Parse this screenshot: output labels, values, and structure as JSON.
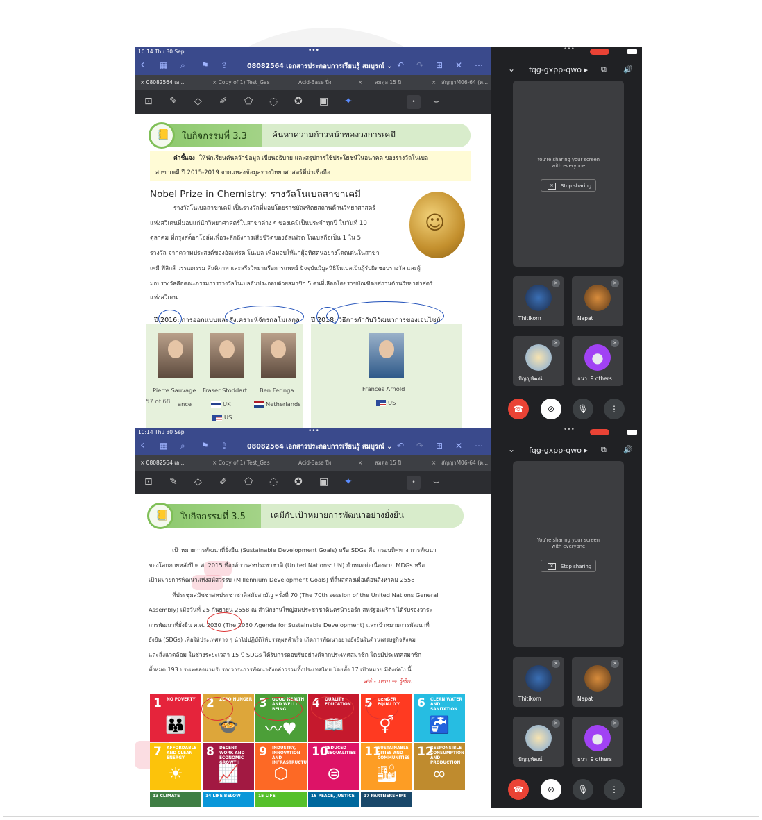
{
  "screens": [
    {
      "status_time": "10:14  Thu 30 Sep",
      "doc_title": "08082564 เอกสารประกอบการเรียนรู้ สมบูรณ์ ⌄",
      "tabs": [
        "× 08082564 เอ...",
        "× Copy of 1) Test_Gas",
        "Acid-Base ปี่ง",
        "×",
        "สมดุล 15 ปี",
        "×",
        "สัญญาM06-64 (ต..."
      ],
      "activity_label": "ใบกิจกรรมที่ 3.3",
      "activity_title": "ค้นหาความก้าวหน้าของวงการเคมี",
      "instruction_label": "คำชี้แจง",
      "instruction_text": "ให้นักเรียนค้นคว้าข้อมูล เขียนอธิบาย และสรุปการใช้ประโยชน์ในอนาคต ของรางวัลโนเบล",
      "instruction_text2": "สาขาเคมี ปี 2015-2019 จากแหล่งข้อมูลทางวิทยาศาสตร์ที่น่าเชื่อถือ",
      "heading": "Nobel Prize in Chemistry: รางวัลโนเบลสาขาเคมี",
      "paragraph": [
        "รางวัลโนเบลสาขาเคมี เป็นรางวัลที่มอบโดยราชบัณฑิตยสถานด้านวิทยาศาสตร์",
        "แห่งสวีเดนที่มอบแก่นักวิทยาศาสตร์ในสาขาต่าง ๆ ของเคมีเป็นประจำทุกปี ในวันที่ 10",
        "ตุลาคม ที่กรุงสต็อกโฮล์มเพื่อระลึกถึงการเสียชีวิตของอัลเฟรด โนเบลถือเป็น 1 ใน 5",
        "รางวัล จากความประสงค์ของอัลเฟรด โนเบล เพื่อมอบให้แก่ผู้อุทิศตนอย่างโดดเด่นในสาขา",
        "เคมี ฟิสิกส์ วรรณกรรม สันติภาพ และสรีรวิทยาหรือการแพทย์ ปัจจุบันมีมูลนิธิโนเบลเป็นผู้รับผิดชอบรางวัล และผู้",
        "มอบรางวัลคือคณะกรรมการรางวัลโนเบลอันประกอบด้วยสมาชิก 5 คนที่เลือกโดยราชบัณฑิตยสถานด้านวิทยาศาสตร์",
        "แห่งสวีเดน"
      ],
      "year_left": "ปี 2016: การออกแบบและสังเคราะห์จักรกลโมเลกุล",
      "year_right": "ปี 2018: วิธีการกำกับวิวัฒนาการของเอนไซม์",
      "laureates": [
        {
          "name": "Pierre Sauvage",
          "country": "ance"
        },
        {
          "name": "Fraser Stoddart",
          "country": "UK",
          "country2": "US"
        },
        {
          "name": "Ben Feringa",
          "country": "Netherlands"
        },
        {
          "name": "Frances Arnold",
          "country": "US"
        }
      ],
      "page_indicator": "57 of 68"
    },
    {
      "status_time": "10:14  Thu 30 Sep",
      "doc_title": "08082564 เอกสารประกอบการเรียนรู้ สมบูรณ์ ⌄",
      "tabs": [
        "× 08082564 เอ...",
        "× Copy of 1) Test_Gas",
        "Acid-Base ปี่ง",
        "×",
        "สมดุล 15 ปี",
        "×",
        "สัญญาM06-64 (ต..."
      ],
      "activity_label": "ใบกิจกรรมที่ 3.5",
      "activity_title": "เคมีกับเป้าหมายการพัฒนาอย่างยั่งยืน",
      "paragraph": [
        "เป้าหมายการพัฒนาที่ยั่งยืน (Sustainable Development Goals) หรือ SDGs คือ กรอบทิศทาง การพัฒนา",
        "ของโลกภายหลังปี ค.ศ. 2015 ที่องค์การสหประชาชาติ (United Nations: UN) กำหนดต่อเนื่องจาก MDGs หรือ",
        "เป้าหมายการพัฒนาแห่งสหัสวรรษ (Millennium Development Goals) ที่สิ้นสุดลงเมื่อเดือนสิงหาคม 2558",
        "ที่ประชุมสมัชชาสหประชาชาติสมัยสามัญ ครั้งที่ 70 (The 70th session of the United Nations General",
        "Assembly) เมื่อวันที่ 25 กันยายน 2558 ณ สำนักงานใหญ่สหประชาชาตินครนิวยอร์ก สหรัฐอเมริกา ได้รับรองวาระ",
        "การพัฒนาที่ยั่งยืน ค.ศ. 2030 (The 2030 Agenda for Sustainable Development) และเป้าหมายการพัฒนาที่",
        "ยั่งยืน (SDGs) เพื่อให้ประเทศต่าง ๆ นำไปปฏิบัติให้บรรลุผลสำเร็จ เกิดการพัฒนาอย่างยั่งยืนในด้านเศรษฐกิจสังคม",
        "และสิ่งแวดล้อม ในช่วงระยะเวลา 15 ปี SDGs ได้รับการตอบรับอย่างดีจากประเทศสมาชิก โดยมีประเทศสมาชิก",
        "ทั้งหมด 193 ประเทศลงนามรับรองวาระการพัฒนาดังกล่าวรวมทั้งประเทศไทย โดยทั้ง 17 เป้าหมาย มีดังต่อไปนี้"
      ],
      "handwritten": "สซ์ - กขก  →  รู้ซ็ก.",
      "sdgs": [
        {
          "num": "1",
          "title": "NO POVERTY",
          "glyph": "👪",
          "color": "#e5243b"
        },
        {
          "num": "2",
          "title": "ZERO HUNGER",
          "glyph": "🍲",
          "color": "#dda63a"
        },
        {
          "num": "3",
          "title": "GOOD HEALTH AND WELL-BEING",
          "glyph": "〰♥",
          "color": "#4c9f38"
        },
        {
          "num": "4",
          "title": "QUALITY EDUCATION",
          "glyph": "📖",
          "color": "#c5192d"
        },
        {
          "num": "5",
          "title": "GENDER EQUALITY",
          "glyph": "⚥",
          "color": "#ff3a21"
        },
        {
          "num": "6",
          "title": "CLEAN WATER AND SANITATION",
          "glyph": "🚰",
          "color": "#26bde2"
        },
        {
          "num": "7",
          "title": "AFFORDABLE AND CLEAN ENERGY",
          "glyph": "☀",
          "color": "#fcc30b"
        },
        {
          "num": "8",
          "title": "DECENT WORK AND ECONOMIC GROWTH",
          "glyph": "📈",
          "color": "#a21942"
        },
        {
          "num": "9",
          "title": "INDUSTRY, INNOVATION AND INFRASTRUCTURE",
          "glyph": "⬡",
          "color": "#fd6925"
        },
        {
          "num": "10",
          "title": "REDUCED INEQUALITIES",
          "glyph": "⊜",
          "color": "#dd1367"
        },
        {
          "num": "11",
          "title": "SUSTAINABLE CITIES AND COMMUNITIES",
          "glyph": "🏙",
          "color": "#fd9d24"
        },
        {
          "num": "12",
          "title": "RESPONSIBLE CONSUMPTION AND PRODUCTION",
          "glyph": "∞",
          "color": "#bf8b2e"
        }
      ],
      "sdgs_row3": [
        "13 CLIMATE",
        "14 LIFE BELOW",
        "15 LIFE",
        "16 PEACE, JUSTICE",
        "17 PARTNERSHIPS"
      ]
    }
  ],
  "meet": {
    "meeting_code": "fqg-gxpp-qwo ▸",
    "sharing_text": "You're sharing your screen",
    "sharing_text2": "with everyone",
    "stop_sharing": "Stop sharing",
    "participants": [
      "Thitikorn",
      "Napat",
      "ปัญญพัฒน์",
      "ธนา"
    ],
    "others": "9 others"
  }
}
